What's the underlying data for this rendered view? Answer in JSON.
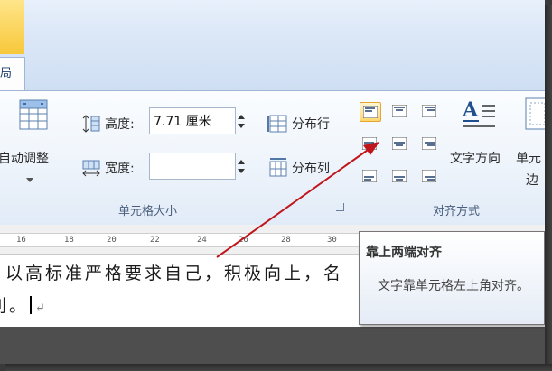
{
  "colors": {
    "accent_arrow": "#c0151b",
    "selected_button": "#ffd86a",
    "ribbon_bg": "#eef4fb"
  },
  "tab": {
    "partial_label": "局"
  },
  "size_group": {
    "label": "单元格大小",
    "autofit_label_line1": "自动调整",
    "height_label": "高度:",
    "height_value": "7.71 厘米",
    "width_label": "宽度:",
    "width_value": "",
    "distribute_rows": "分布行",
    "distribute_cols": "分布列"
  },
  "align_group": {
    "label": "对齐方式",
    "text_direction": "文字方向",
    "cell_margins_line1": "单元",
    "cell_margins_line2": "边",
    "buttons": [
      "top-left",
      "top-center",
      "top-right",
      "middle-left",
      "middle-center",
      "middle-right",
      "bottom-left",
      "bottom-center",
      "bottom-right"
    ],
    "selected": "top-left"
  },
  "ruler": {
    "ticks": [
      "16",
      "18",
      "20",
      "22",
      "24",
      "26",
      "28",
      "30"
    ]
  },
  "document": {
    "line1": "以高标准严格要求自己，积极向上，",
    "line1_clip": "名",
    "line2": "利。"
  },
  "tooltip": {
    "title": "靠上两端对齐",
    "description": "文字靠单元格左上角对齐。"
  }
}
